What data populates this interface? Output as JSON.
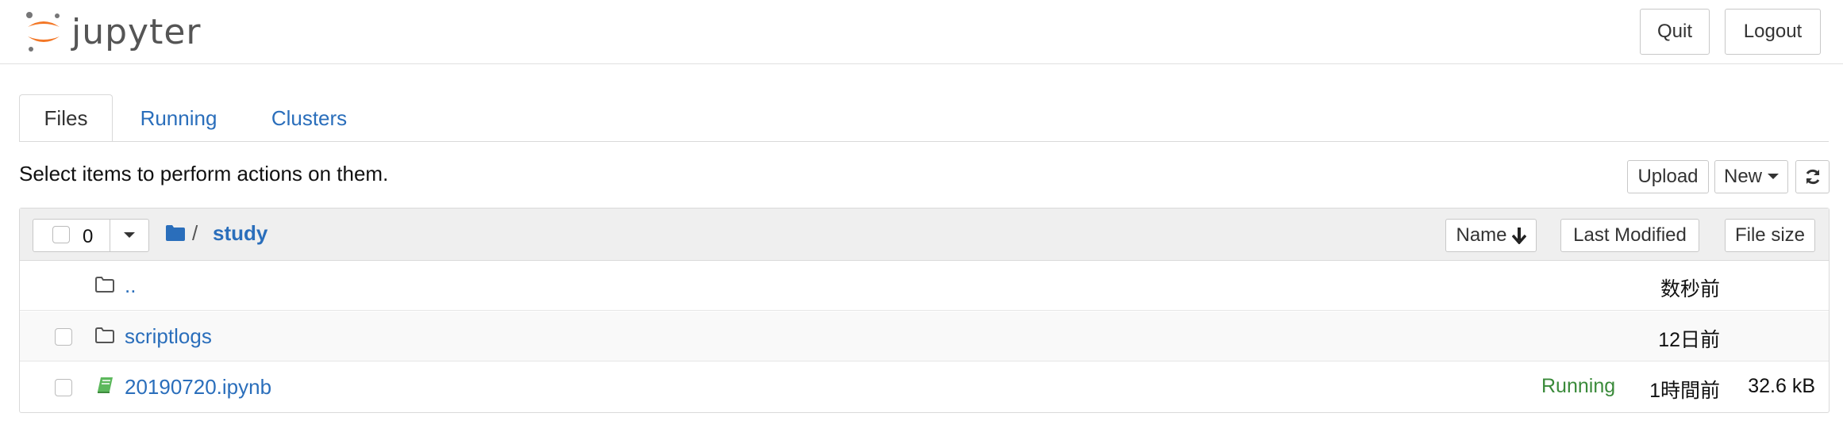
{
  "header": {
    "logo_text": "jupyter",
    "quit_label": "Quit",
    "logout_label": "Logout"
  },
  "tabs": [
    {
      "label": "Files",
      "active": true
    },
    {
      "label": "Running",
      "active": false
    },
    {
      "label": "Clusters",
      "active": false
    }
  ],
  "instructions": "Select items to perform actions on them.",
  "toolbar": {
    "upload_label": "Upload",
    "new_label": "New",
    "refresh_icon": "refresh-icon"
  },
  "list_header": {
    "selected_count": "0",
    "path_separator": "/",
    "path_current": "study",
    "sort_name_label": "Name",
    "sort_modified_label": "Last Modified",
    "sort_size_label": "File size"
  },
  "rows": [
    {
      "name": "..",
      "type": "folder",
      "modified": "数秒前",
      "status": "",
      "size": ""
    },
    {
      "name": "scriptlogs",
      "type": "folder",
      "modified": "12日前",
      "status": "",
      "size": ""
    },
    {
      "name": "20190720.ipynb",
      "type": "notebook",
      "modified": "1時間前",
      "status": "Running",
      "size": "32.6 kB"
    }
  ],
  "colors": {
    "link": "#2a6ebb",
    "running": "#3a8a3a",
    "jupyter_orange": "#f37726",
    "notebook_green": "#5cb85c"
  }
}
